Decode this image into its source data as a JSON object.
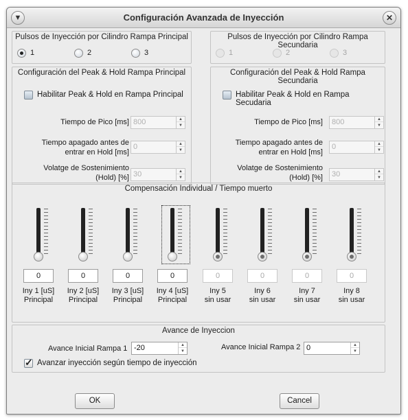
{
  "window": {
    "title": "Configuración Avanzada de Inyección"
  },
  "pulsos_principal": {
    "title": "Pulsos de Inyección por Cilindro Rampa Principal",
    "options": [
      "1",
      "2",
      "3"
    ],
    "selected": "1"
  },
  "pulsos_secundaria": {
    "title": "Pulsos de Inyección por Cilindro Rampa Secundaria",
    "options": [
      "1",
      "2",
      "3"
    ]
  },
  "peak_principal": {
    "title": "Configuración del Peak & Hold Rampa Principal",
    "enable_label": "Habilitar Peak & Hold en Rampa Principal",
    "tiempo_pico_label": "Tiempo de Pico [ms]",
    "tiempo_pico_value": "800",
    "tiempo_apagado_label_1": "Tiempo apagado antes de",
    "tiempo_apagado_label_2": "entrar en Hold [ms]",
    "tiempo_apagado_value": "0",
    "voltaje_label_1": "Volatge de Sostenimiento",
    "voltaje_label_2": "(Hold) [%]",
    "voltaje_value": "30"
  },
  "peak_secundaria": {
    "title": "Configuración del Peak & Hold Rampa Secundaria",
    "enable_label": "Habilitar Peak & Hold en Rampa Secudaria",
    "tiempo_pico_label": "Tiempo de Pico [ms]",
    "tiempo_pico_value": "800",
    "tiempo_apagado_label_1": "Tiempo apagado antes de",
    "tiempo_apagado_label_2": "entrar en Hold [ms]",
    "tiempo_apagado_value": "0",
    "voltaje_label_1": "Volatge de Sostenimiento",
    "voltaje_label_2": "(Hold) [%]",
    "voltaje_value": "30"
  },
  "compensacion": {
    "title": "Compensación Individual / Tiempo muerto",
    "injectors": [
      {
        "value": "0",
        "line1": "Iny 1 [uS]",
        "line2": "Principal",
        "enabled": true,
        "level": 0
      },
      {
        "value": "0",
        "line1": "Iny 2 [uS]",
        "line2": "Principal",
        "enabled": true,
        "level": 0
      },
      {
        "value": "0",
        "line1": "Iny 3 [uS]",
        "line2": "Principal",
        "enabled": true,
        "level": 0
      },
      {
        "value": "0",
        "line1": "Iny 4 [uS]",
        "line2": "Principal",
        "enabled": true,
        "level": 0
      },
      {
        "value": "0",
        "line1": "Iny 5",
        "line2": "sin usar",
        "enabled": false,
        "level": 0
      },
      {
        "value": "0",
        "line1": "Iny 6",
        "line2": "sin usar",
        "enabled": false,
        "level": 0
      },
      {
        "value": "0",
        "line1": "Iny 7",
        "line2": "sin usar",
        "enabled": false,
        "level": 0
      },
      {
        "value": "0",
        "line1": "Iny 8",
        "line2": "sin usar",
        "enabled": false,
        "level": 0
      }
    ]
  },
  "avance": {
    "title": "Avance de Inyeccion",
    "rampa1_label": "Avance Inicial Rampa 1",
    "rampa1_value": "-20",
    "rampa2_label": "Avance Inicial Rampa 2",
    "rampa2_value": "0",
    "check_label": "Avanzar inyección según tiempo de inyección",
    "check_checked": true
  },
  "buttons": {
    "ok": "OK",
    "cancel": "Cancel"
  }
}
